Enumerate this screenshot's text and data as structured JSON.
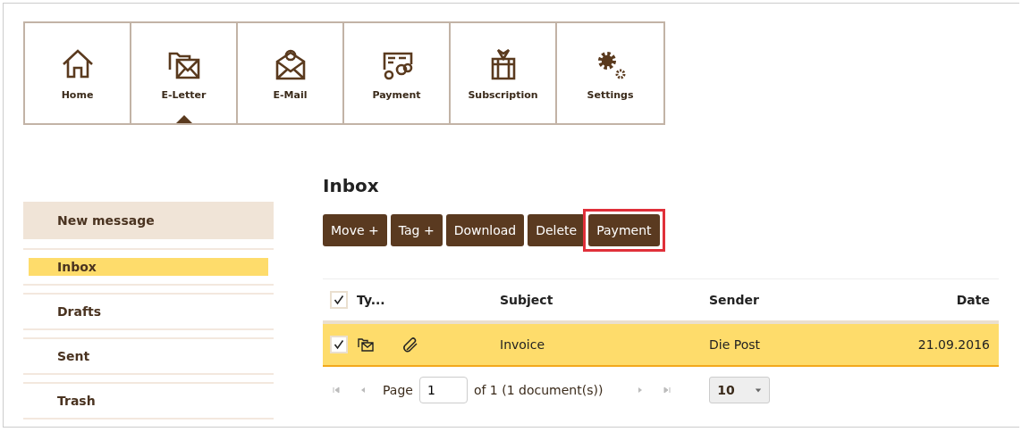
{
  "nav": [
    {
      "label": "Home",
      "kind": "home",
      "selected": false
    },
    {
      "label": "E-Letter",
      "kind": "letter",
      "selected": true
    },
    {
      "label": "E-Mail",
      "kind": "email",
      "selected": false
    },
    {
      "label": "Payment",
      "kind": "payment",
      "selected": false
    },
    {
      "label": "Subscription",
      "kind": "gift",
      "selected": false
    },
    {
      "label": "Settings",
      "kind": "gears",
      "selected": false
    }
  ],
  "sidebar": {
    "action": "New message",
    "items": [
      {
        "label": "Inbox",
        "selected": true
      },
      {
        "label": "Drafts",
        "selected": false
      },
      {
        "label": "Sent",
        "selected": false
      },
      {
        "label": "Trash",
        "selected": false
      }
    ]
  },
  "title": "Inbox",
  "toolbar": [
    {
      "label": "Move +",
      "highlighted": false
    },
    {
      "label": "Tag +",
      "highlighted": false
    },
    {
      "label": "Download",
      "highlighted": false
    },
    {
      "label": "Delete",
      "highlighted": false
    },
    {
      "label": "Payment",
      "highlighted": true
    }
  ],
  "table": {
    "all_checked": true,
    "columns": [
      "Ty...",
      "Subject",
      "Sender",
      "Date"
    ],
    "rows": [
      {
        "checked": true,
        "selected": true,
        "attachment": true,
        "subject": "Invoice",
        "sender": "Die Post",
        "date": "21.09.2016"
      }
    ]
  },
  "pager": {
    "page_label": "Page",
    "page": "1",
    "of": "of 1 (1 document(s))",
    "page_size": "10"
  }
}
